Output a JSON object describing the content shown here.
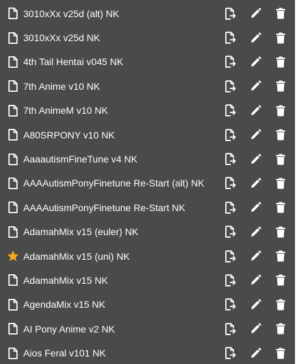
{
  "models": [
    {
      "name": "3010xXx v25d (alt) NK",
      "icon": "file-icon"
    },
    {
      "name": "3010xXx v25d NK",
      "icon": "file-icon"
    },
    {
      "name": "4th Tail Hentai v045 NK",
      "icon": "file-icon"
    },
    {
      "name": "7th Anime v10 NK",
      "icon": "file-icon"
    },
    {
      "name": "7th AnimeM v10 NK",
      "icon": "file-icon"
    },
    {
      "name": "A80SRPONY v10 NK",
      "icon": "file-icon"
    },
    {
      "name": "AaaautismFineTune v4 NK",
      "icon": "file-icon"
    },
    {
      "name": "AAAAutismPonyFinetune Re-Start (alt) NK",
      "icon": "file-icon"
    },
    {
      "name": "AAAAutismPonyFinetune Re-Start NK",
      "icon": "file-icon"
    },
    {
      "name": "AdamahMix v15 (euler) NK",
      "icon": "file-icon"
    },
    {
      "name": "AdamahMix v15 (uni) NK",
      "icon": "star-icon"
    },
    {
      "name": "AdamahMix v15 NK",
      "icon": "file-icon"
    },
    {
      "name": "AgendaMix v15 NK",
      "icon": "file-icon"
    },
    {
      "name": "AI Pony Anime v2 NK",
      "icon": "file-icon"
    },
    {
      "name": "Aios Feral v101 NK",
      "icon": "file-icon"
    }
  ],
  "row_actions": [
    "file-export-icon",
    "pencil-icon",
    "trash-icon"
  ],
  "colors": {
    "panel_background": "#4a4a4a",
    "text": "#ffffff",
    "star": "#f0a81c"
  }
}
